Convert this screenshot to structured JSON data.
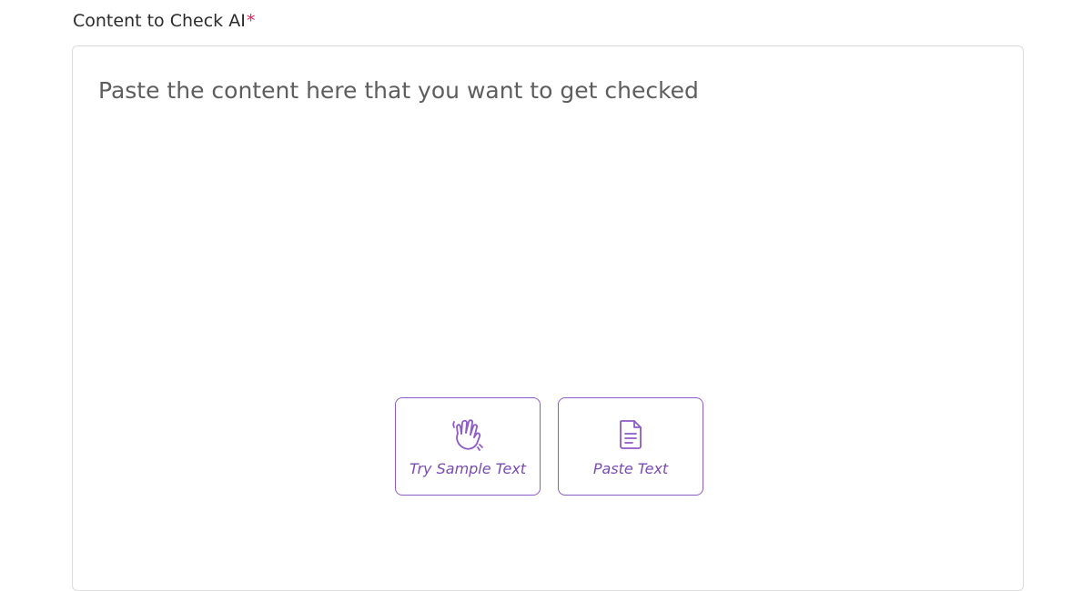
{
  "field": {
    "label": "Content to Check AI",
    "required_marker": "*"
  },
  "content_input": {
    "placeholder": "Paste the content here that you want to get checked",
    "value": ""
  },
  "actions": {
    "sample_label": "Try Sample Text",
    "paste_label": "Paste Text"
  },
  "colors": {
    "accent": "#8e5bc7",
    "required": "#e0245e",
    "border": "#dcdcdc"
  },
  "icons": {
    "sample": "waving-hand-icon",
    "paste": "document-icon"
  }
}
